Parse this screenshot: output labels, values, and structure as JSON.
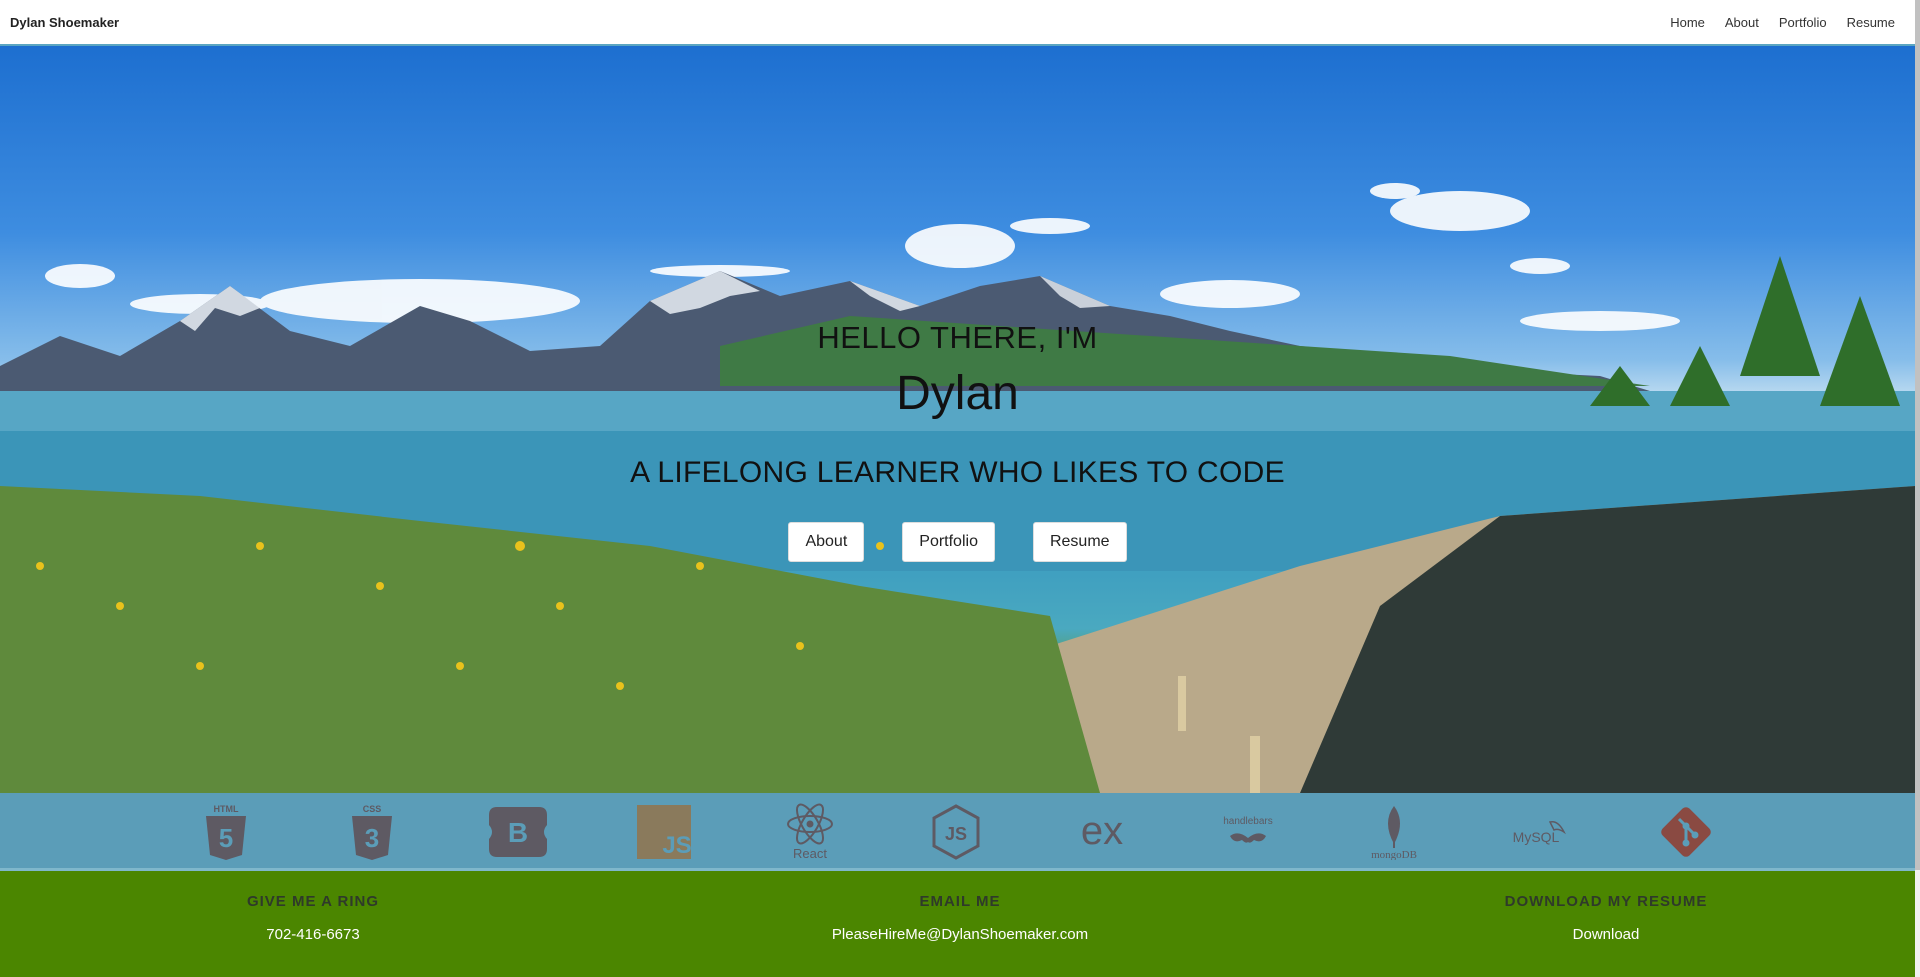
{
  "navbar": {
    "brand": "Dylan Shoemaker",
    "links": [
      "Home",
      "About",
      "Portfolio",
      "Resume"
    ]
  },
  "hero": {
    "greeting": "HELLO THERE, I'M",
    "name": "Dylan",
    "tagline": "A LIFELONG LEARNER WHO LIKES TO CODE",
    "buttons": [
      "About",
      "Portfolio",
      "Resume"
    ]
  },
  "tech_icons": [
    {
      "icon": "html5-icon",
      "label": "HTML"
    },
    {
      "icon": "css3-icon",
      "label": "CSS"
    },
    {
      "icon": "bootstrap-icon",
      "label": "B"
    },
    {
      "icon": "javascript-icon",
      "label": "JS"
    },
    {
      "icon": "react-icon",
      "label": "React"
    },
    {
      "icon": "nodejs-icon",
      "label": "JS"
    },
    {
      "icon": "express-icon",
      "label": "ex"
    },
    {
      "icon": "handlebars-icon",
      "label": "handlebars"
    },
    {
      "icon": "mongodb-icon",
      "label": "mongoDB"
    },
    {
      "icon": "mysql-icon",
      "label": "MySQL"
    },
    {
      "icon": "git-icon",
      "label": ""
    }
  ],
  "footer": {
    "phone": {
      "heading": "GIVE ME A RING",
      "value": "702-416-6673"
    },
    "email": {
      "heading": "EMAIL ME",
      "value": "PleaseHireMe@DylanShoemaker.com"
    },
    "resume": {
      "heading": "DOWNLOAD MY RESUME",
      "value": "Download"
    }
  },
  "colors": {
    "tech_strip": "#5b9db8",
    "footer": "#4b8600",
    "icon_gray": "#5e5a63"
  }
}
